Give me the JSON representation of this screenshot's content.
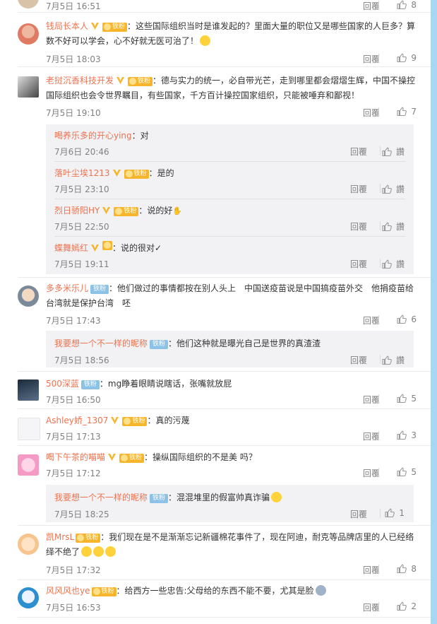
{
  "top_partial": {
    "time": "7月5日 16:51",
    "reply": "回覆",
    "likes": "8"
  },
  "comments": [
    {
      "user": "钱局长本人",
      "text": "：这些国际组织当时是谁发起的？里面大量的职位又是哪些国家的人巨多？算数不好可以学会，心不好就无医可治了！",
      "time": "7月5日 18:03",
      "reply": "回覆",
      "likes": "9",
      "has_v": true,
      "fan_label": "铁粉"
    },
    {
      "user": "老挝沉香科技开发",
      "text": "：德与实力的统一，必自带光芒，走到哪里都会熠熠生辉，中国不操控国际组织也会令世界瞩目，有些国家，千方百计操控国家组织，只能被唾弃和鄙视！",
      "time": "7月5日 19:10",
      "reply": "回覆",
      "likes": "7",
      "has_v": true,
      "fan_label": "铁粉",
      "subs": [
        {
          "user": "喝养乐多的开心ying",
          "text": "：对",
          "time": "7月6日 20:46",
          "reply": "回覆",
          "like_label": "讚"
        },
        {
          "user": "落叶尘埃1213",
          "text": "：是的",
          "time": "7月5日 23:10",
          "reply": "回覆",
          "like_label": "讚",
          "fan_label": "铁粉"
        },
        {
          "user": "烈日骄阳HY",
          "text": "：说的好",
          "time": "7月5日 22:50",
          "reply": "回覆",
          "like_label": "讚",
          "fan_label": "铁粉"
        },
        {
          "user": "蝶舞嫣红",
          "text": "：说的很对✓",
          "time": "7月5日 19:11",
          "reply": "回覆",
          "like_label": "讚"
        }
      ]
    },
    {
      "user": "多多米乐儿",
      "text": "：他们做过的事情都按在别人头上　中国送疫苗说是中国搞疫苗外交　他捐疫苗给台湾就是保护台湾　呸",
      "time": "7月5日 17:43",
      "reply": "回覆",
      "likes": "6",
      "tie_label": "铁粉",
      "subs": [
        {
          "user": "我要想一个不一样的昵称",
          "text": "：他们这种就是曝光自己是世界的真渣渣",
          "time": "7月5日 18:56",
          "reply": "回覆",
          "like_label": "讚",
          "tie_label": "铁粉"
        }
      ]
    },
    {
      "user": "500深蓝",
      "text": "：mg睁着眼睛说瞎话，张嘴就放屁",
      "time": "7月5日 16:50",
      "reply": "回覆",
      "likes": "5",
      "tie_label": "铁粉"
    },
    {
      "user": "Ashley娇_1307",
      "text": "：真的污蔑",
      "time": "7月5日 17:13",
      "reply": "回覆",
      "likes": "3",
      "has_v": true,
      "fan_label": "铁粉"
    },
    {
      "user": "喝下午茶的喵喵",
      "text": "：操纵国际组织的不是美 吗？",
      "time": "7月5日 17:12",
      "reply": "回覆",
      "likes": "5",
      "has_v": true,
      "fan_label": "铁粉",
      "subs": [
        {
          "user": "我要想一个不一样的昵称",
          "text": "：混混堆里的假富帅真诈骗",
          "time": "7月5日 18:25",
          "reply": "回覆",
          "likes": "1",
          "tie_label": "铁粉"
        }
      ]
    },
    {
      "user": "凯MrsL",
      "text": "：我们现在是不是渐渐忘记新疆棉花事件了，现在阿迪，耐克等品牌店里的人已经络绎不绝了",
      "time": "7月5日 17:32",
      "reply": "回覆",
      "likes": "8",
      "fan_label": "铁粉"
    },
    {
      "user": "风风风也ye",
      "text": "：给西方一些忠告:父母给的东西不能不要，尤其是脸",
      "time": "7月5日 16:53",
      "reply": "回覆",
      "likes": "2",
      "fan_label": "铁粉"
    }
  ]
}
